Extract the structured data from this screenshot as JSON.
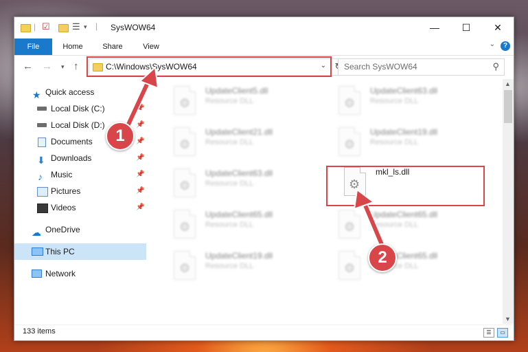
{
  "window": {
    "title": "SysWOW64",
    "controls": {
      "minimize": "—",
      "maximize": "☐",
      "close": "✕"
    }
  },
  "ribbon": {
    "tabs": [
      {
        "label": "File"
      },
      {
        "label": "Home"
      },
      {
        "label": "Share"
      },
      {
        "label": "View"
      }
    ],
    "help": "?"
  },
  "address": {
    "path": "C:\\Windows\\SysWOW64"
  },
  "search": {
    "placeholder": "Search SysWOW64"
  },
  "sidebar": {
    "items": [
      {
        "label": "Quick access",
        "icon": "star-icon"
      },
      {
        "label": "Local Disk (C:)",
        "icon": "drive-icon",
        "pinned": true
      },
      {
        "label": "Local Disk (D:)",
        "icon": "drive-icon",
        "pinned": true
      },
      {
        "label": "Documents",
        "icon": "documents-icon",
        "pinned": true
      },
      {
        "label": "Downloads",
        "icon": "downloads-icon",
        "pinned": true
      },
      {
        "label": "Music",
        "icon": "music-icon",
        "pinned": true
      },
      {
        "label": "Pictures",
        "icon": "pictures-icon",
        "pinned": true
      },
      {
        "label": "Videos",
        "icon": "videos-icon",
        "pinned": true
      },
      {
        "label": "OneDrive",
        "icon": "cloud-icon"
      },
      {
        "label": "This PC",
        "icon": "monitor-icon",
        "selected": true
      },
      {
        "label": "Network",
        "icon": "network-icon"
      }
    ]
  },
  "files": [
    {
      "name": "UpdateClient5.dll",
      "type": "Resource DLL",
      "blurred": true
    },
    {
      "name": "UpdateClient63.dll",
      "type": "Resource DLL",
      "blurred": true
    },
    {
      "name": "UpdateClient21.dll",
      "type": "Resource DLL",
      "blurred": true
    },
    {
      "name": "UpdateClient19.dll",
      "type": "Resource DLL",
      "blurred": true
    },
    {
      "name": "UpdateClient63.dll",
      "type": "Resource DLL",
      "blurred": true
    },
    {
      "name": "mkl_ls.dll",
      "type": "",
      "blurred": false
    },
    {
      "name": "UpdateClient65.dll",
      "type": "Resource DLL",
      "blurred": true
    },
    {
      "name": "UpdateClient65.dll",
      "type": "Resource DLL",
      "blurred": true
    },
    {
      "name": "UpdateClient19.dll",
      "type": "Resource DLL",
      "blurred": true
    },
    {
      "name": "UpdateClient65.dll",
      "type": "Resource DLL",
      "blurred": true
    }
  ],
  "status": {
    "item_count": "133 items"
  },
  "callouts": [
    {
      "number": "1"
    },
    {
      "number": "2"
    }
  ],
  "colors": {
    "accent": "#1979ca",
    "highlight": "#d9464a",
    "selection": "#cce4f7"
  }
}
